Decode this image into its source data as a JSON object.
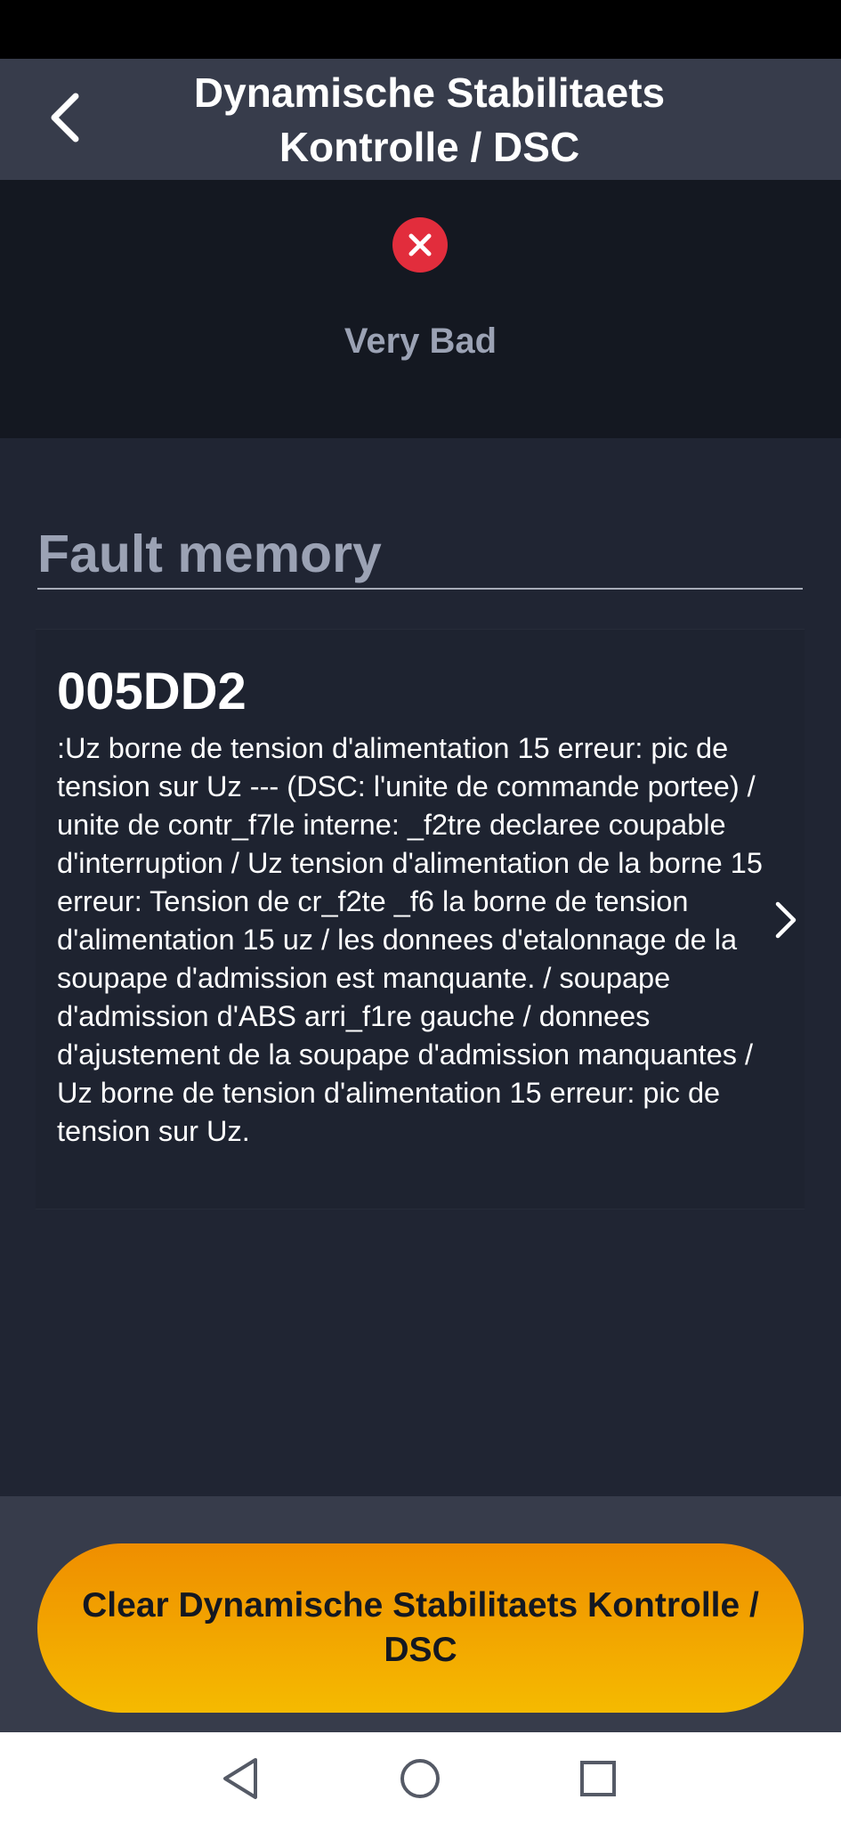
{
  "header": {
    "title": "Dynamische Stabilitaets Kontrolle / DSC",
    "back_icon": "chevron-left-icon"
  },
  "status": {
    "label": "Very Bad",
    "icon": "error-x-icon",
    "color": "#e22d3c"
  },
  "fault_memory": {
    "title": "Fault memory",
    "items": [
      {
        "code": "005DD2",
        "description": ":Uz borne de tension d'alimentation 15 erreur: pic de tension sur Uz --- (DSC: l'unite de commande portee) / unite de contr_f7le interne: _f2tre declaree coupable d'interruption / Uz tension d'alimentation de la borne 15 erreur: Tension de cr_f2te _f6 la borne de tension d'alimentation 15 uz / les donnees d'etalonnage de la soupape d'admission est manquante. / soupape d'admission d'ABS arri_f1re gauche / donnees d'ajustement de la soupape d'admission manquantes / Uz borne de tension d'alimentation 15 erreur: pic de tension sur Uz.",
        "icon": "chevron-right-icon"
      }
    ]
  },
  "footer": {
    "clear_label": "Clear Dynamische Stabilitaets Kontrolle / DSC",
    "accent_color": "#f5ba00"
  },
  "nav": {
    "back_icon": "triangle-back-icon",
    "home_icon": "circle-home-icon",
    "recents_icon": "square-recents-icon"
  }
}
